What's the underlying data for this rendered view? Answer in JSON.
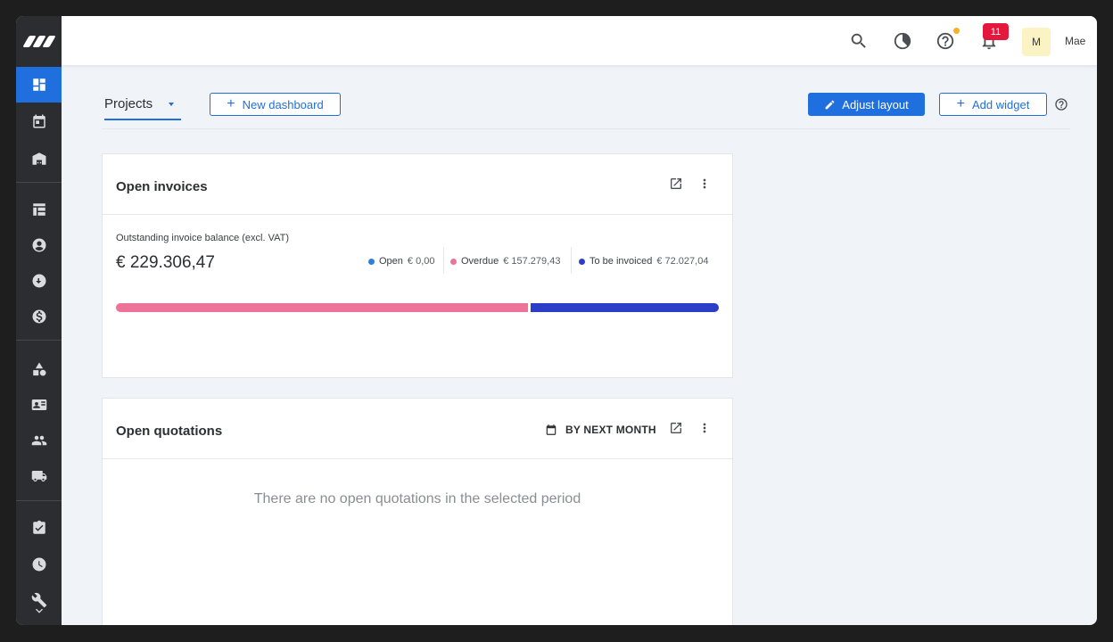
{
  "sidebar": {
    "items": [
      {
        "name": "dashboard-icon",
        "active": true
      },
      {
        "name": "calendar-icon"
      },
      {
        "name": "warehouse-icon"
      },
      {
        "name": "table-icon"
      },
      {
        "name": "account-circle-icon"
      },
      {
        "name": "sync-icon"
      },
      {
        "name": "dollar-icon"
      },
      {
        "name": "shapes-icon"
      },
      {
        "name": "contact-card-icon"
      },
      {
        "name": "people-icon"
      },
      {
        "name": "truck-icon"
      },
      {
        "name": "checklist-icon"
      },
      {
        "name": "clock-icon"
      },
      {
        "name": "wrench-icon"
      },
      {
        "name": "chevron-down-icon"
      }
    ]
  },
  "topbar": {
    "notification_count": "11",
    "avatar_initial": "M",
    "username": "Mae"
  },
  "toolbar": {
    "dashboard_tab": "Projects",
    "new_dashboard_label": "New dashboard",
    "adjust_layout_label": "Adjust layout",
    "add_widget_label": "Add widget"
  },
  "open_invoices": {
    "title": "Open invoices",
    "subtitle": "Outstanding invoice balance (excl. VAT)",
    "total": "€ 229.306,47",
    "legend": [
      {
        "label": "Open",
        "amount": "€ 0,00",
        "color": "#2f7fe0",
        "value": 0
      },
      {
        "label": "Overdue",
        "amount": "€ 157.279,43",
        "color": "#ee7399",
        "value": 157279.43
      },
      {
        "label": "To be invoiced",
        "amount": "€ 72.027,04",
        "color": "#2c3ec7",
        "value": 72027.04
      }
    ]
  },
  "open_quotations": {
    "title": "Open quotations",
    "filter_label": "BY NEXT MONTH",
    "empty_message": "There are no open quotations in the selected period"
  },
  "colors": {
    "accent": "#1f6fde",
    "sidebar": "#2b2d30",
    "badge": "#e3183c"
  }
}
